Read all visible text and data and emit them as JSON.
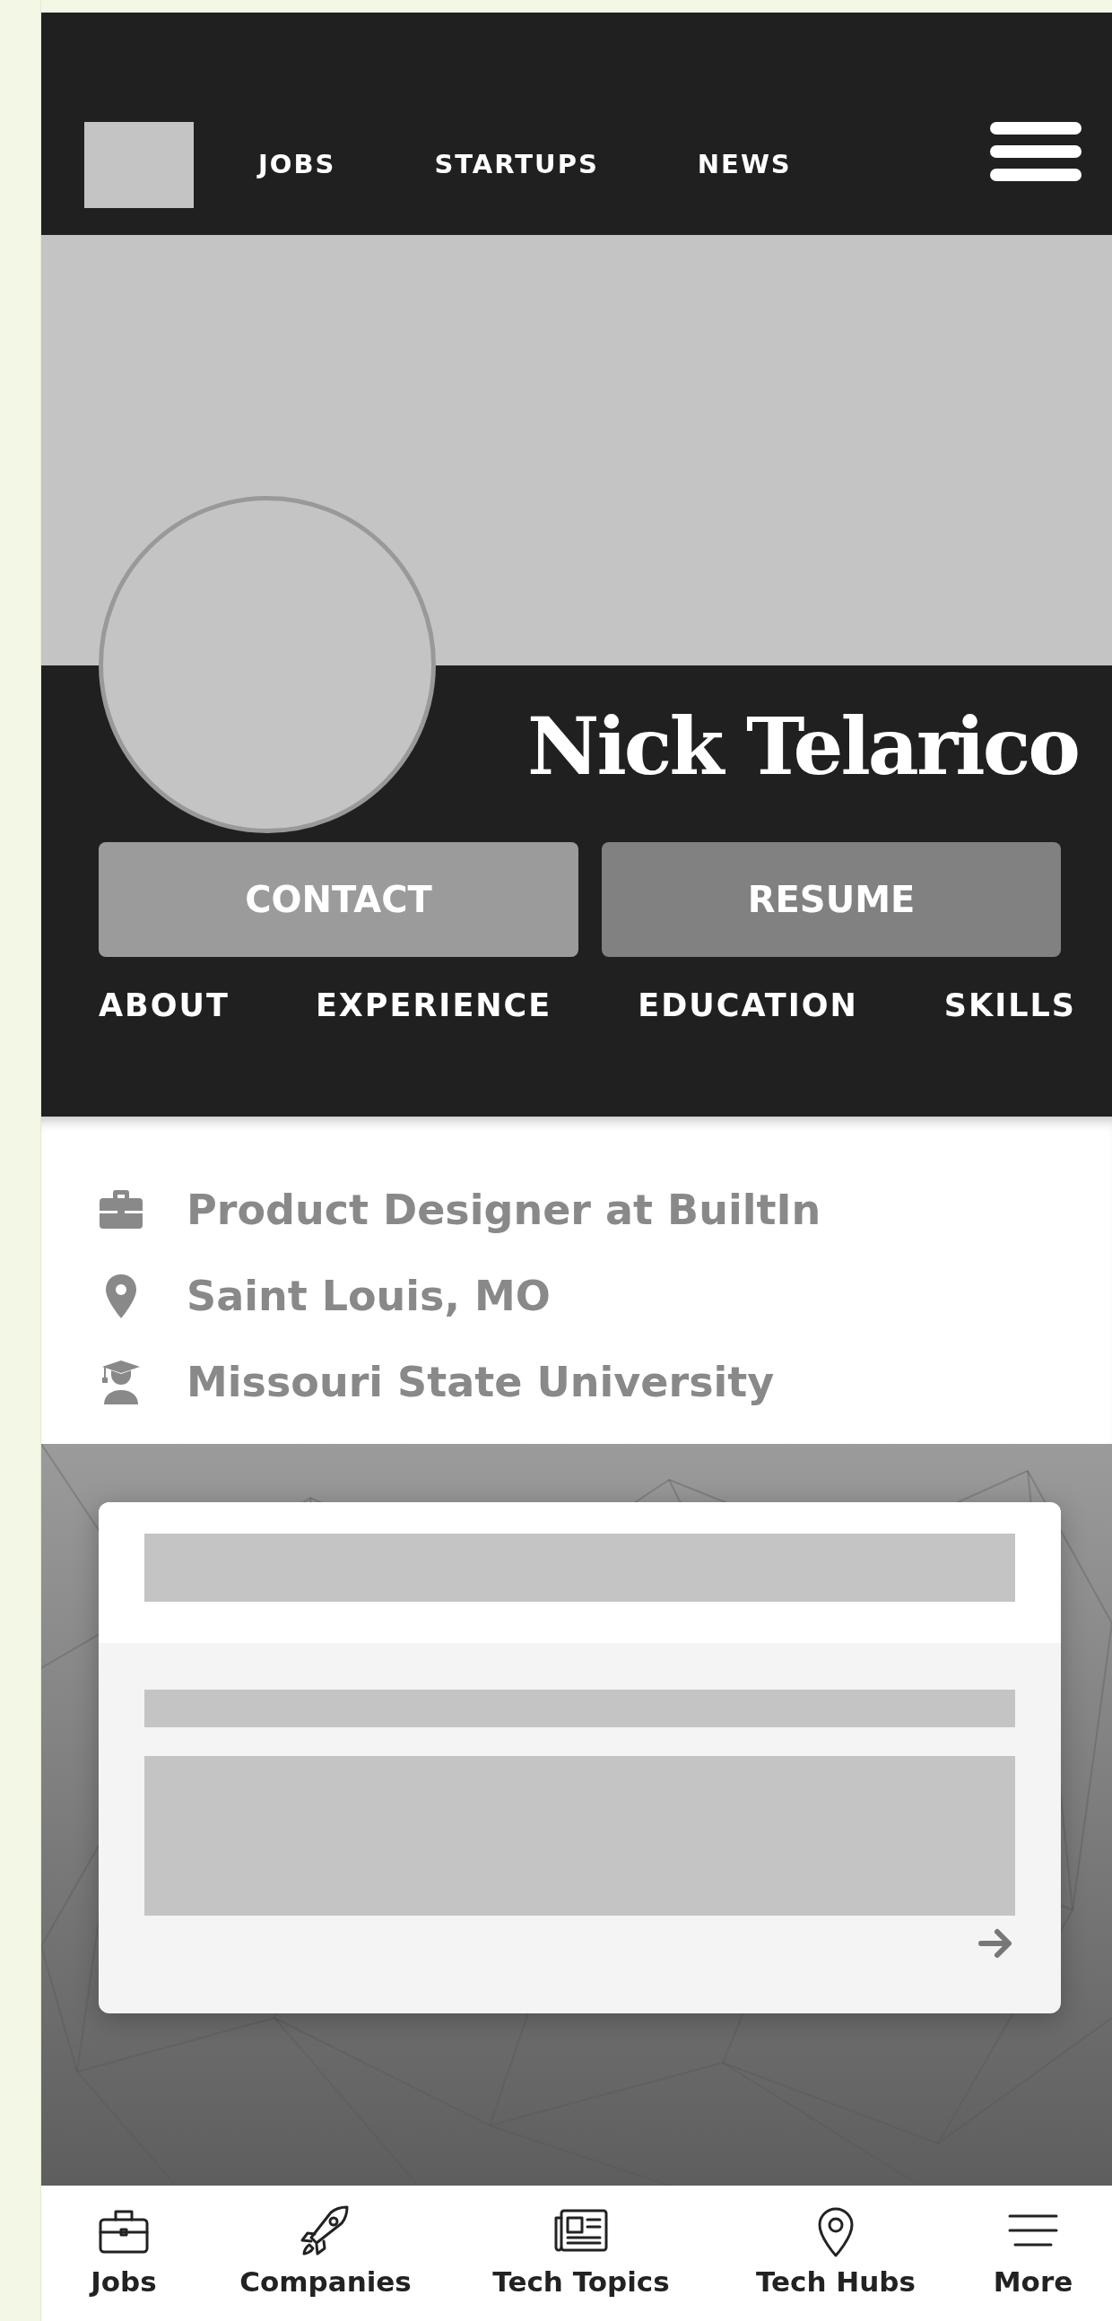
{
  "nav": {
    "links": [
      "JOBS",
      "STARTUPS",
      "NEWS"
    ]
  },
  "profile": {
    "name": "Nick Telarico",
    "buttons": [
      "CONTACT",
      "RESUME"
    ],
    "tabs": [
      "ABOUT",
      "EXPERIENCE",
      "EDUCATION",
      "SKILLS"
    ]
  },
  "details": [
    {
      "kind": "job",
      "text": "Product Designer at BuiltIn"
    },
    {
      "kind": "location",
      "text": "Saint Louis, MO"
    },
    {
      "kind": "education",
      "text": "Missouri State University"
    }
  ],
  "bottom_nav": [
    {
      "kind": "jobs",
      "label": "Jobs"
    },
    {
      "kind": "companies",
      "label": "Companies"
    },
    {
      "kind": "topics",
      "label": "Tech Topics"
    },
    {
      "kind": "hubs",
      "label": "Tech Hubs"
    },
    {
      "kind": "more",
      "label": "More"
    }
  ]
}
